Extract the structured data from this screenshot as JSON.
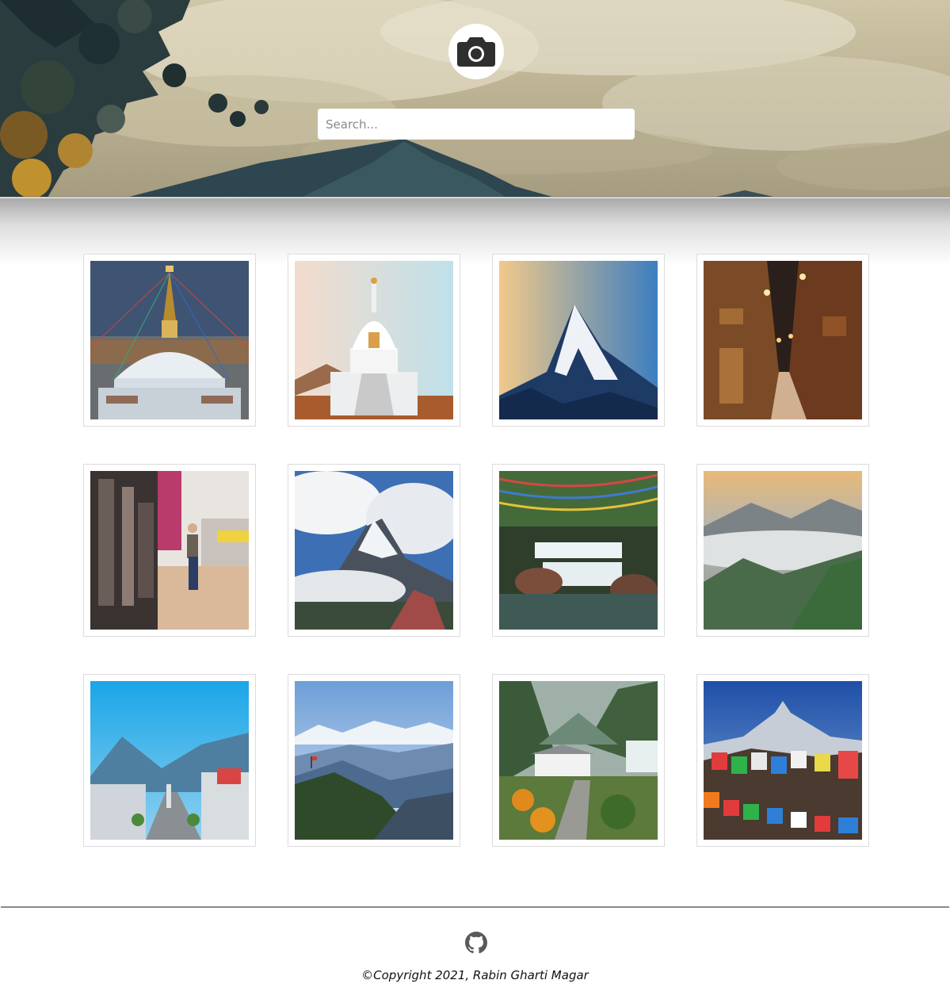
{
  "header": {
    "logo_icon": "camera-icon",
    "search_placeholder": "Search...",
    "search_value": ""
  },
  "gallery": {
    "photos": [
      {
        "subject": "boudhanath-stupa"
      },
      {
        "subject": "world-peace-pagoda"
      },
      {
        "subject": "snow-peak-sunrise"
      },
      {
        "subject": "old-town-night-alley"
      },
      {
        "subject": "street-market"
      },
      {
        "subject": "mountain-above-clouds"
      },
      {
        "subject": "waterfall-prayer-flags"
      },
      {
        "subject": "misty-valley-sunrise"
      },
      {
        "subject": "city-valley-street"
      },
      {
        "subject": "himalaya-range-view"
      },
      {
        "subject": "mountain-village-path"
      },
      {
        "subject": "machapuchare-prayer-flags"
      }
    ]
  },
  "footer": {
    "github_icon": "github-icon",
    "copyright_symbol": "©",
    "copyright_text": "Copyright 2021, Rabin Gharti Magar"
  },
  "colors": {
    "footer_line": "#8a8a8a",
    "card_border": "#dcdcdc",
    "text": "#111111"
  }
}
